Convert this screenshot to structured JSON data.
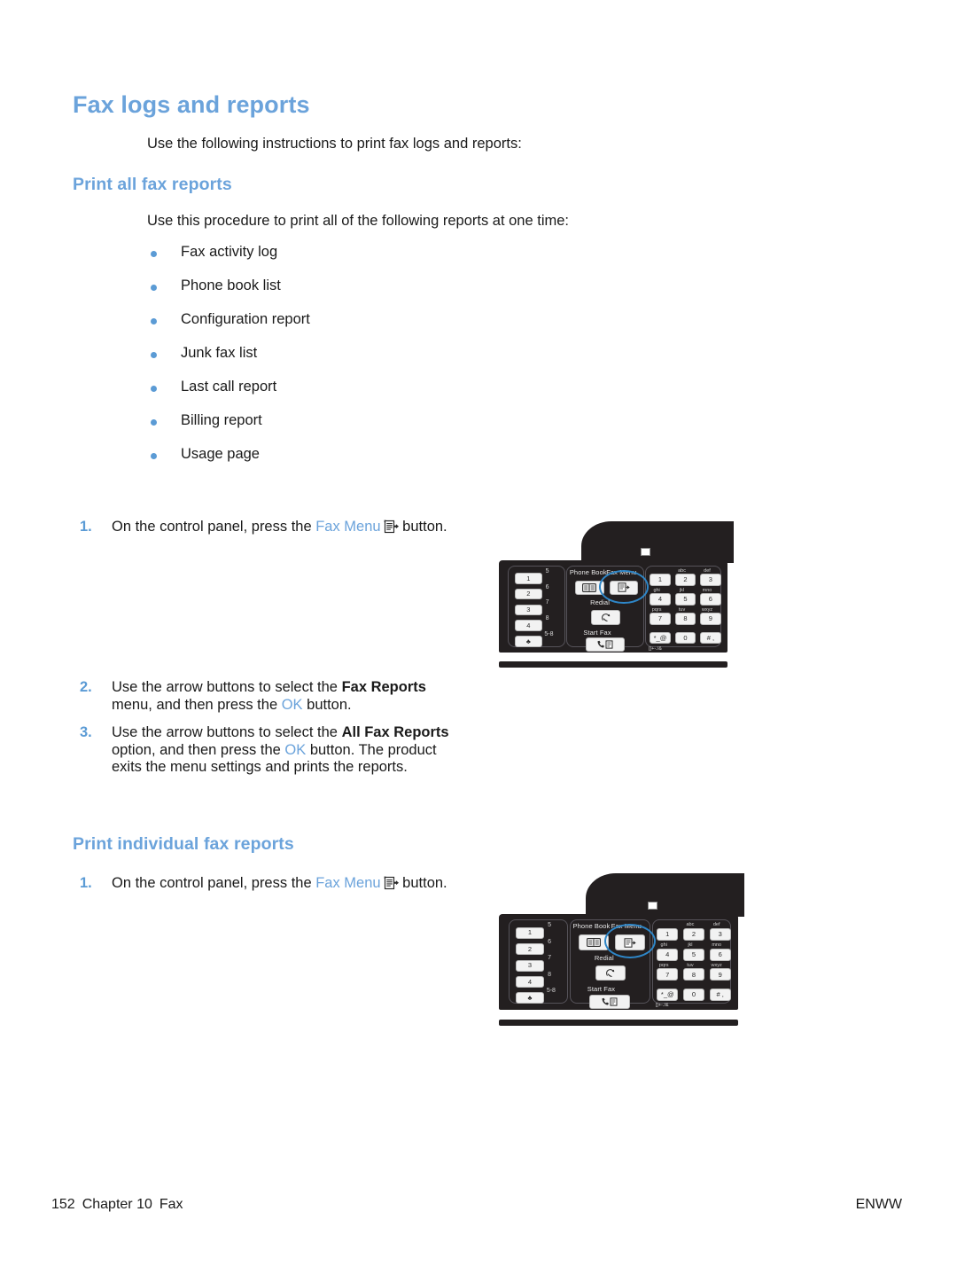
{
  "page": {
    "title": "Fax logs and reports",
    "intro": "Use the following instructions to print fax logs and reports:"
  },
  "sections": {
    "print_all": {
      "heading": "Print all fax reports",
      "intro": "Use this procedure to print all of the following reports at one time:",
      "report_list": [
        "Fax activity log",
        "Phone book list",
        "Configuration report",
        "Junk fax list",
        "Last call report",
        "Billing report",
        "Usage page"
      ],
      "steps": [
        {
          "number": "1.",
          "text_before": "On the control panel, press the ",
          "link": "Fax Menu",
          "icon": "fax-menu-document-icon",
          "text_after": " button."
        },
        {
          "number": "2.",
          "seg1": "Use the arrow buttons to select the ",
          "bold1": "Fax Reports",
          "seg2": " menu, and then press the ",
          "blue1": "OK",
          "seg3": " button."
        },
        {
          "number": "3.",
          "seg1": "Use the arrow buttons to select the ",
          "bold1": "All Fax Reports",
          "seg2": " option, and then press the ",
          "blue1": "OK",
          "seg3": " button. The product exits the menu settings and prints the reports."
        }
      ]
    },
    "print_individual": {
      "heading": "Print individual fax reports",
      "steps": [
        {
          "number": "1.",
          "text_before": "On the control panel, press the ",
          "link": "Fax Menu",
          "icon": "fax-menu-document-icon",
          "text_after": " button."
        }
      ]
    }
  },
  "control_panel": {
    "speed_dials": [
      {
        "primary": "1",
        "secondary": "5"
      },
      {
        "primary": "2",
        "secondary": "6"
      },
      {
        "primary": "3",
        "secondary": "7"
      },
      {
        "primary": "4",
        "secondary": "8"
      },
      {
        "primary": "♣",
        "secondary": "5-8"
      }
    ],
    "fax_labels": {
      "phone_book": "Phone Book",
      "fax_menu": "Fax Menu",
      "redial": "Redial",
      "start_fax": "Start Fax"
    },
    "keypad": [
      {
        "digit": "1",
        "letters": ""
      },
      {
        "digit": "2",
        "letters": "abc"
      },
      {
        "digit": "3",
        "letters": "def"
      },
      {
        "digit": "4",
        "letters": "ghi"
      },
      {
        "digit": "5",
        "letters": "jkl"
      },
      {
        "digit": "6",
        "letters": "mno"
      },
      {
        "digit": "7",
        "letters": "pqrs"
      },
      {
        "digit": "8",
        "letters": "tuv"
      },
      {
        "digit": "9",
        "letters": "wxyz"
      },
      {
        "digit": "*_@",
        "letters": ""
      },
      {
        "digit": "0",
        "letters": ""
      },
      {
        "digit": "# ,",
        "letters": ""
      }
    ],
    "symbol_legend": "[]+-./&",
    "highlight_target": "Fax Menu"
  },
  "footer": {
    "page_number": "152",
    "chapter": "Chapter 10",
    "chapter_title": "Fax",
    "locale": "ENWW"
  },
  "colors": {
    "heading_blue": "#6BA3DB",
    "bullet_blue": "#5B9BD5",
    "highlight_blue": "#2E86C7",
    "panel_black": "#231F20",
    "body_text": "#1a1a1a"
  }
}
